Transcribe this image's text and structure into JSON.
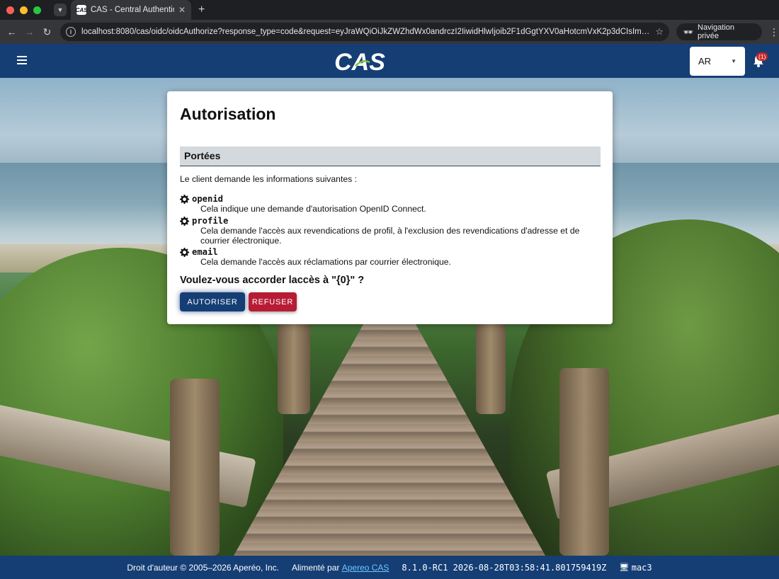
{
  "browser": {
    "tab_title": "CAS - Central Authentication",
    "tab_favicon_text": "CAS",
    "url": "localhost:8080/cas/oidc/oidcAuthorize?response_type=code&request=eyJraWQiOiJkZWZhdWx0andrczI2IiwidHlwIjoib2F1dGgtYXV0aHotcmVxK2p3dCIsImFsZyI6IlJ...",
    "incognito_label": "Navigation privée"
  },
  "header": {
    "logo_text": "CAS",
    "language_value": "AR",
    "notification_count": "(1)"
  },
  "card": {
    "title": "Autorisation",
    "scopes_heading": "Portées",
    "intro": "Le client demande les informations suivantes :",
    "scopes": [
      {
        "name": "openid",
        "description": "Cela indique une demande d'autorisation OpenID Connect."
      },
      {
        "name": "profile",
        "description": "Cela demande l'accès aux revendications de profil, à l'exclusion des revendications d'adresse et de courrier électronique."
      },
      {
        "name": "email",
        "description": "Cela demande l'accès aux réclamations par courrier électronique."
      }
    ],
    "question": "Voulez-vous accorder laccès à \"{0}\" ?",
    "authorize_label": "AUTORISER",
    "deny_label": "REFUSER"
  },
  "footer": {
    "copyright": "Droit d'auteur © 2005–2026 Aperéo, Inc.",
    "powered_by": "Alimenté par",
    "powered_link": "Apereo CAS",
    "version": "8.1.0-RC1 2026-08-28T03:58:41.801759419Z",
    "host": "mac3"
  },
  "colors": {
    "brand": "#153e75",
    "deny": "#b71c34"
  }
}
